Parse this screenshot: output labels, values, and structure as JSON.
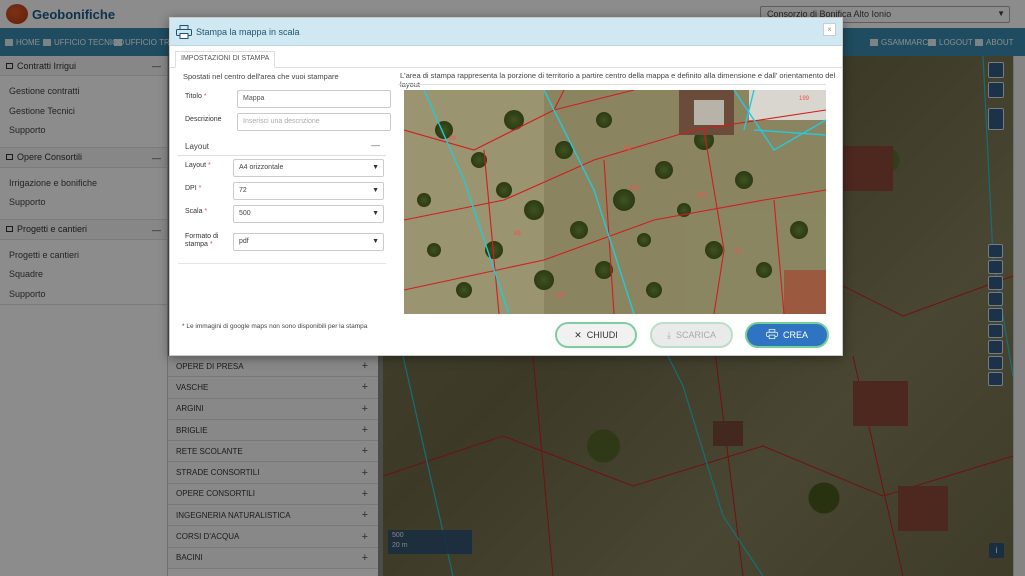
{
  "app": {
    "name": "Geobonifiche",
    "consortium": "Consorzio di Bonifica Alto Ionio"
  },
  "nav": {
    "left": [
      "HOME",
      "UFFICIO TECNICO",
      "UFFICIO TRIBUTI"
    ],
    "right": [
      "GSAMMARCO",
      "LOGOUT",
      "ABOUT"
    ]
  },
  "sidebar": {
    "sections": [
      {
        "title": "Contratti Irrigui",
        "links": [
          "Gestione contratti",
          "Gestione Tecnici",
          "Supporto"
        ]
      },
      {
        "title": "Opere Consortili",
        "links": [
          "Irrigazione e bonifiche",
          "Supporto"
        ]
      },
      {
        "title": "Progetti e cantieri",
        "links": [
          "Progetti e cantieri",
          "Squadre",
          "Supporto"
        ]
      }
    ]
  },
  "layers": [
    "OPERE DI PRESA",
    "VASCHE",
    "ARGINI",
    "BRIGLIE",
    "RETE SCOLANTE",
    "STRADE CONSORTILI",
    "OPERE CONSORTILI",
    "INGEGNERIA NATURALISTICA",
    "CORSI D'ACQUA",
    "BACINI"
  ],
  "map": {
    "scale": "500",
    "scale_bar": "20 m"
  },
  "modal": {
    "title": "Stampa la mappa in scala",
    "tab": "IMPOSTAZIONI DI STAMPA",
    "hint": "Spostati nel centro dell'area che vuoi stampare",
    "preview_text": "L'area di stampa rappresenta la porzione di territorio a partire centro della mappa e definito alla dimensione e dall' orientamento del layout",
    "fields": {
      "titolo": {
        "label": "Titolo",
        "value": "Mappa"
      },
      "descrizione": {
        "label": "Descrizione",
        "placeholder": "Inserisci una descrizione"
      }
    },
    "layout_section": "Layout",
    "selects": {
      "layout": {
        "label": "Layout",
        "value": "A4 orizzontale"
      },
      "dpi": {
        "label": "DPI",
        "value": "72"
      },
      "scala": {
        "label": "Scala",
        "value": "500"
      },
      "formato": {
        "label_line1": "Formato di",
        "label_line2": "stampa",
        "value": "pdf"
      }
    },
    "required_mark": "*",
    "footnote": "* Le immagini di google maps non sono disponibili per la stampa",
    "buttons": {
      "chiudi": "CHIUDI",
      "scarica": "SCARICA",
      "crea": "CREA"
    },
    "parcel_labels": [
      "29",
      "88",
      "89",
      "222",
      "261",
      "90",
      "126",
      "199"
    ]
  },
  "colors": {
    "navbar": "#3a8bb0",
    "header": "#cfe8f2",
    "crea": "#2f73c3",
    "accent_border": "#74cf96",
    "parcel_line": "#d21d1d",
    "road_line": "#27c8d8"
  }
}
